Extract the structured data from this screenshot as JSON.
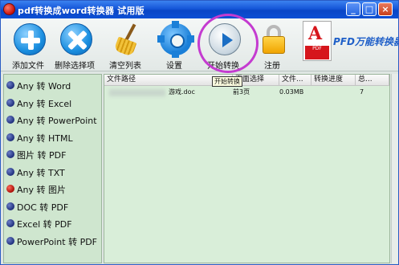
{
  "window": {
    "title": "pdf转换成word转换器 试用版",
    "controls": {
      "minimize": "_",
      "maximize": "□",
      "close": "×"
    }
  },
  "toolbar": {
    "add_files": "添加文件",
    "delete_selected": "删除选择项",
    "clear_list": "清空列表",
    "settings": "设置",
    "start_convert": "开始转换",
    "register": "注册",
    "brand": "PFD万能转换器",
    "logo_letter": "A",
    "logo_band": "PDF"
  },
  "tooltip": "开始转换",
  "modes": [
    {
      "label": "Any 转 Word",
      "selected": false
    },
    {
      "label": "Any 转 Excel",
      "selected": false
    },
    {
      "label": "Any 转 PowerPoint",
      "selected": false
    },
    {
      "label": "Any 转 HTML",
      "selected": false
    },
    {
      "label": "图片 转 PDF",
      "selected": false
    },
    {
      "label": "Any 转 TXT",
      "selected": false
    },
    {
      "label": "Any 转 图片",
      "selected": true
    },
    {
      "label": "DOC 转 PDF",
      "selected": false
    },
    {
      "label": "Excel 转 PDF",
      "selected": false
    },
    {
      "label": "PowerPoint 转 PDF",
      "selected": false
    }
  ],
  "table": {
    "headers": [
      "文件路径",
      "页面选择",
      "文件...",
      "转换进度",
      "总..."
    ],
    "rows": [
      {
        "path": "游戏.doc",
        "pages": "前3页",
        "size": "0.03MB",
        "progress": "",
        "total": "7"
      }
    ]
  },
  "colors": {
    "accent": "#1556d8",
    "highlight_ring": "#c43bd0",
    "list_bg": "#d9eed9"
  }
}
